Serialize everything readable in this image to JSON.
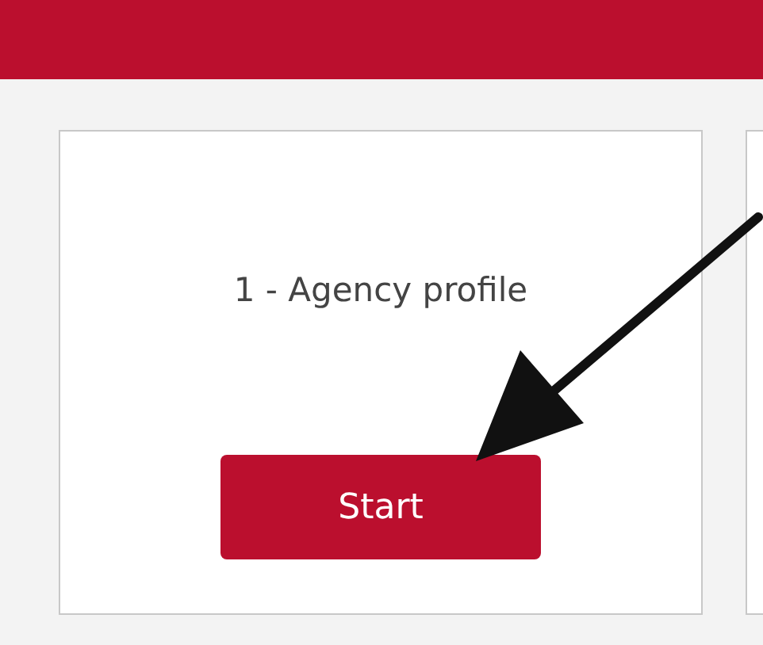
{
  "header": {
    "kind": "bar"
  },
  "cards": [
    {
      "title": "1 - Agency profile",
      "button": "Start"
    },
    {
      "kind": "partial"
    }
  ],
  "annotation": {
    "kind": "arrow"
  }
}
